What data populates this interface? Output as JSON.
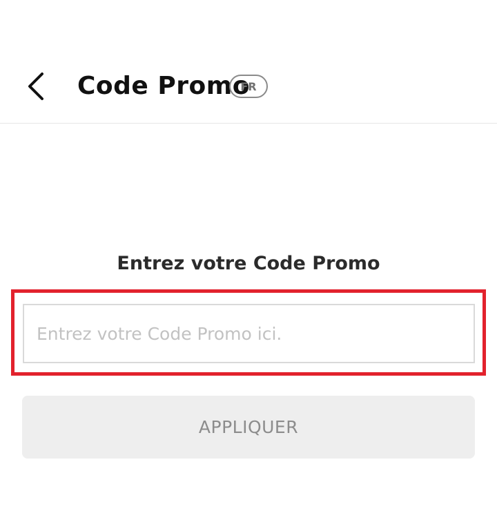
{
  "header": {
    "title": "Code Promo",
    "language_badge": "FR",
    "back_icon": "chevron-left-icon"
  },
  "form": {
    "prompt": "Entrez votre Code Promo",
    "input_placeholder": "Entrez votre Code Promo ici.",
    "input_value": "",
    "apply_label": "APPLIQUER"
  },
  "colors": {
    "highlight": "#e2222d",
    "button_bg": "#eeeeee",
    "button_text": "#8c8c8c",
    "placeholder": "#c2c2c2"
  }
}
